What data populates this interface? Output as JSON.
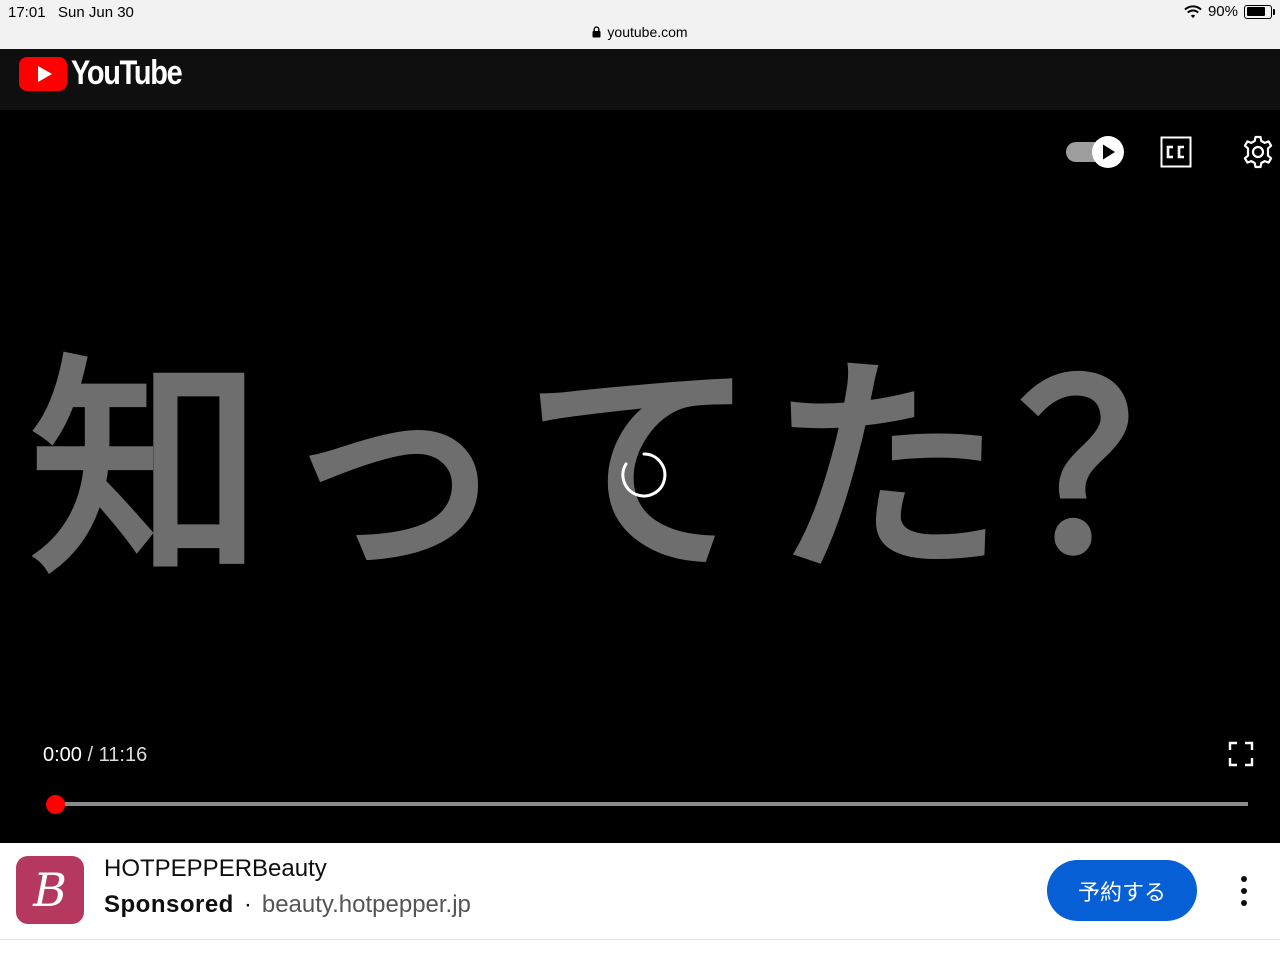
{
  "status_bar": {
    "time": "17:01",
    "date": "Sun Jun 30",
    "battery": "90%",
    "battery_level": 0.9,
    "url": "youtube.com"
  },
  "header": {
    "logo_text": "YouTube",
    "logo_color": "#ff0000"
  },
  "player": {
    "overlay_text": [
      "知",
      "っ",
      "て",
      "た",
      "？"
    ],
    "current_time": "0:00",
    "separator": "/",
    "duration": "11:16",
    "progress": 0,
    "cc_label": "CC",
    "autoplay_on": true
  },
  "ad": {
    "logo_letter": "B",
    "brand_color": "#b5385e",
    "title": "HOTPEPPERBeauty",
    "sponsored": "Sponsored",
    "dot": "·",
    "domain": "beauty.hotpepper.jp",
    "cta": "予約する",
    "cta_color": "#065fd4"
  }
}
